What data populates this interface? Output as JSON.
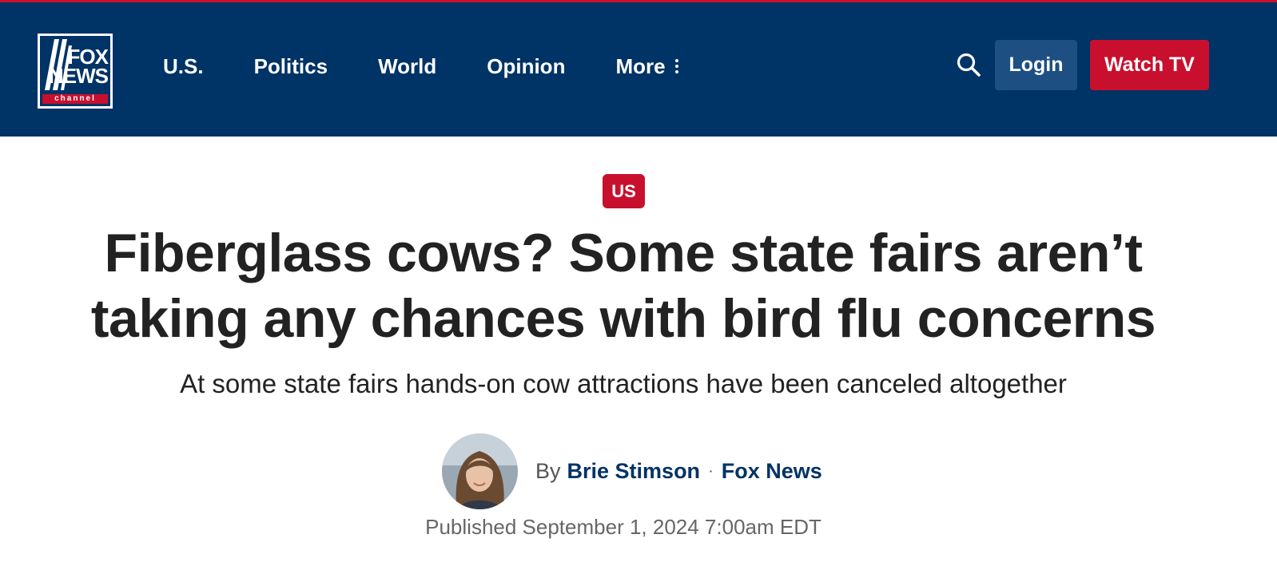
{
  "header": {
    "logo": {
      "line1": "FOX",
      "line2": "NEWS",
      "line3": "channel",
      "icon": "fox-news-logo"
    },
    "nav": [
      {
        "label": "U.S."
      },
      {
        "label": "Politics"
      },
      {
        "label": "World"
      },
      {
        "label": "Opinion"
      },
      {
        "label": "More"
      }
    ],
    "search_icon": "search-icon",
    "login_label": "Login",
    "watch_label": "Watch TV"
  },
  "article": {
    "category": "US",
    "headline": "Fiberglass cows? Some state fairs aren’t taking any chances with bird flu concerns",
    "subheadline": "At some state fairs hands-on cow attractions have been canceled altogether",
    "byline": {
      "prefix": "By",
      "author": "Brie Stimson",
      "separator": "·",
      "source": "Fox News"
    },
    "published": "Published September 1, 2024 7:00am EDT"
  },
  "colors": {
    "header_bg": "#003366",
    "accent_red": "#c8102e",
    "login_bg": "#1d4f82",
    "link_blue": "#003366"
  }
}
